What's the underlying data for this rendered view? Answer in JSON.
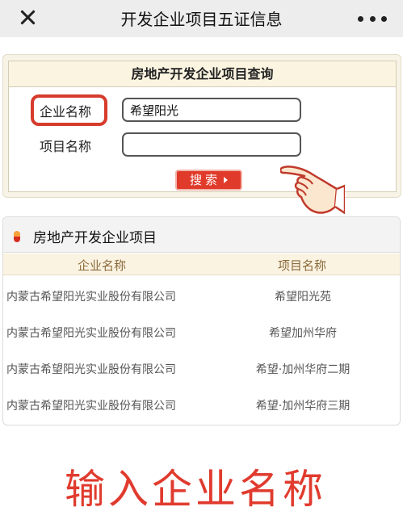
{
  "header": {
    "title": "开发企业项目五证信息"
  },
  "query": {
    "title": "房地产开发企业项目查询",
    "company_label": "企业名称",
    "company_value": "希望阳光",
    "project_label": "项目名称",
    "project_value": "",
    "search_label": "搜索"
  },
  "results": {
    "title": "房地产开发企业项目",
    "columns": [
      "企业名称",
      "项目名称"
    ],
    "rows": [
      {
        "company": "内蒙古希望阳光实业股份有限公司",
        "project": "希望阳光苑"
      },
      {
        "company": "内蒙古希望阳光实业股份有限公司",
        "project": "希望加州华府"
      },
      {
        "company": "内蒙古希望阳光实业股份有限公司",
        "project": "希望·加州华府二期"
      },
      {
        "company": "内蒙古希望阳光实业股份有限公司",
        "project": "希望·加州华府三期"
      }
    ]
  },
  "caption": "输入企业名称",
  "colors": {
    "accent_red": "#e03a2a",
    "panel_cream": "#f7f3e6",
    "column_header_bg": "#fbf3e2"
  }
}
